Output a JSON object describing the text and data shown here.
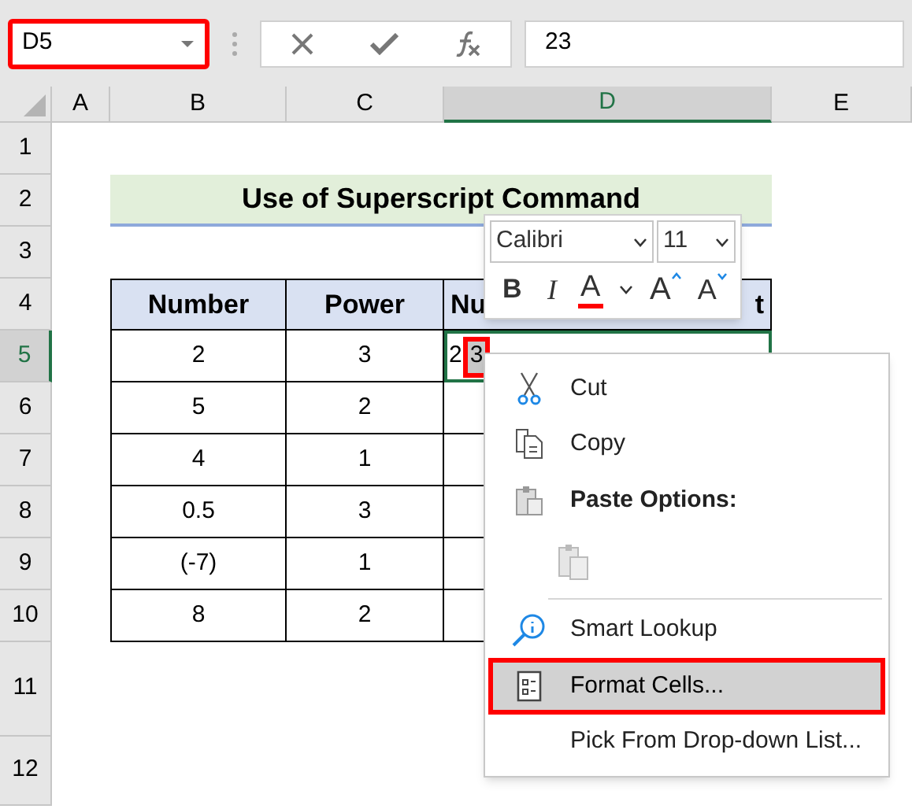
{
  "formula_bar": {
    "name_box": "D5",
    "name_box_highlighted": true,
    "formula": "23"
  },
  "columns": [
    {
      "label": "A",
      "selected": false
    },
    {
      "label": "B",
      "selected": false
    },
    {
      "label": "C",
      "selected": false
    },
    {
      "label": "D",
      "selected": true
    },
    {
      "label": "E",
      "selected": false
    }
  ],
  "rows": [
    {
      "label": "1",
      "selected": false
    },
    {
      "label": "2",
      "selected": false
    },
    {
      "label": "3",
      "selected": false
    },
    {
      "label": "4",
      "selected": false
    },
    {
      "label": "5",
      "selected": true
    },
    {
      "label": "6",
      "selected": false
    },
    {
      "label": "7",
      "selected": false
    },
    {
      "label": "8",
      "selected": false
    },
    {
      "label": "9",
      "selected": false
    },
    {
      "label": "10",
      "selected": false
    },
    {
      "label": "11",
      "selected": false
    },
    {
      "label": "12",
      "selected": false
    }
  ],
  "title": "Use of Superscript Command",
  "table": {
    "columns": [
      "Number",
      "Power"
    ],
    "third_header_start": "Nu",
    "third_header_end": "t",
    "rows": [
      {
        "number": "2",
        "power": "3"
      },
      {
        "number": "5",
        "power": "2"
      },
      {
        "number": "4",
        "power": "1"
      },
      {
        "number": "0.5",
        "power": "3"
      },
      {
        "number": "(-7)",
        "power": "1"
      },
      {
        "number": "8",
        "power": "2"
      }
    ]
  },
  "active_cell": {
    "text_start": "2",
    "text_selected": "3",
    "selection_highlighted": true
  },
  "mini_toolbar": {
    "font": "Calibri",
    "size": "11",
    "buttons": [
      {
        "kind": "bold",
        "label": "B"
      },
      {
        "kind": "italic",
        "label": "I"
      },
      {
        "kind": "font_color",
        "label": "A"
      },
      {
        "kind": "grow",
        "label": "A"
      },
      {
        "kind": "shrink",
        "label": "A"
      }
    ]
  },
  "context_menu": {
    "items": [
      {
        "kind": "cut",
        "label": "Cut",
        "selected": false
      },
      {
        "kind": "copy",
        "label": "Copy",
        "selected": false
      },
      {
        "kind": "paste_header",
        "label": "Paste Options:",
        "selected": false
      },
      {
        "kind": "paste_option",
        "selected": false
      },
      {
        "kind": "smart_lookup",
        "label": "Smart Lookup",
        "selected": false
      },
      {
        "kind": "format_cells",
        "label": "Format Cells...",
        "selected": true
      },
      {
        "kind": "pick_list",
        "label": "Pick From Drop-down List...",
        "selected": false
      }
    ]
  }
}
